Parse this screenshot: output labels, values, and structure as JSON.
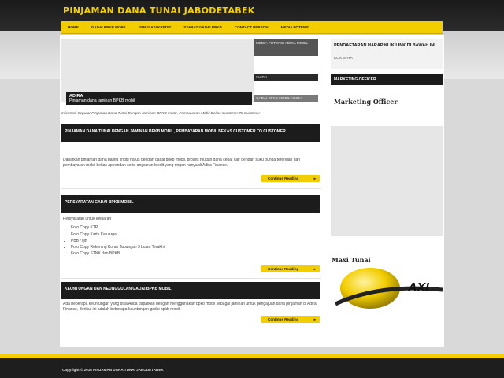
{
  "header": {
    "site_title": "PINJAMAN DANA TUNAI JABODETABEK"
  },
  "nav": {
    "items": [
      {
        "label": "HOME"
      },
      {
        "label": "GADAI BPKB MOBIL"
      },
      {
        "label": "SIMULASI KREDIT"
      },
      {
        "label": "SYARAT GADAI BPKB"
      },
      {
        "label": "CONTACT PERSON"
      },
      {
        "label": "MEDIA POTENSI"
      }
    ]
  },
  "slider": {
    "caption_title": "ADIRA",
    "caption_subtitle": "Pinjaman dana jaminan BPKB mobil",
    "thumb1": "MEDIA POTENSI ADIRA MOBIL",
    "thumb2": "ADIRA",
    "thumb3": "GADAI BPKB MOBIL ADIRA"
  },
  "notice": "Informasi Seputar Pinjaman Dana Tunai Dengan Jaminan BPKB motor, Pembayaran Mobil Bekas Customer To Customer",
  "posts": [
    {
      "title": "PINJAMAN DANA TUNAI DENGAN JAMINAN BPKB MOBIL, PEMBAYARAN MOBIL BEKAS CUSTOMER TO CUSTOMER",
      "body": "Dapatkan pinjaman dana paling tinggi harus dengan gadai bpkb mobil, proses mudah dana cepat cair dengan suku bunga terendah dan pembayaran mobil bekas ap rendah serta angsuran kredit yang ringan hanya di Adira Finance.",
      "more": "Continue Reading"
    },
    {
      "title": "PERSYARATAN GADAI BPKB MOBIL",
      "intro": "Persyaratan untuk keluarah",
      "list": [
        "Foto Copy KTP",
        "Foto Copy Kartu Keluarga",
        "PBB / Ijin",
        "Foto Copy Rekening Koran Tabungan 3 bulan Terakhir",
        "Foto Copy STNK dan BPKB"
      ],
      "more": "Continue Reading"
    },
    {
      "title": "KEUNTUNGAN DAN KEUNGGULAN GADAI BPKB MOBIL",
      "body": "Ada beberapa keuntungan yang bisa Anda dapatkan dengan menggunakan bpkb mobil sebagai jaminan untuk pengajuan dana pinjaman di Adira Finance, Berikut ini adalah beberapa keuntungan gadai bpkb mobil",
      "more": "Continue Reading"
    }
  ],
  "sidebar": {
    "notice_title": "PENDAFTARAN HARAP KLIK LINK DI BAWAH INI",
    "notice_link": "KLIK SAYA",
    "marketing_header": "MARKETING OFFICER",
    "marketing_title": "Marketing Officer",
    "maxi_title": "Maxi Tunai",
    "maxi_logo_text": "AXI"
  },
  "footer": {
    "copyright": "Copyright © 2016 PINJAMAN DANA TUNAI JABODETABEK"
  },
  "colors": {
    "accent": "#f2cd00",
    "dark": "#1c1c1c"
  }
}
